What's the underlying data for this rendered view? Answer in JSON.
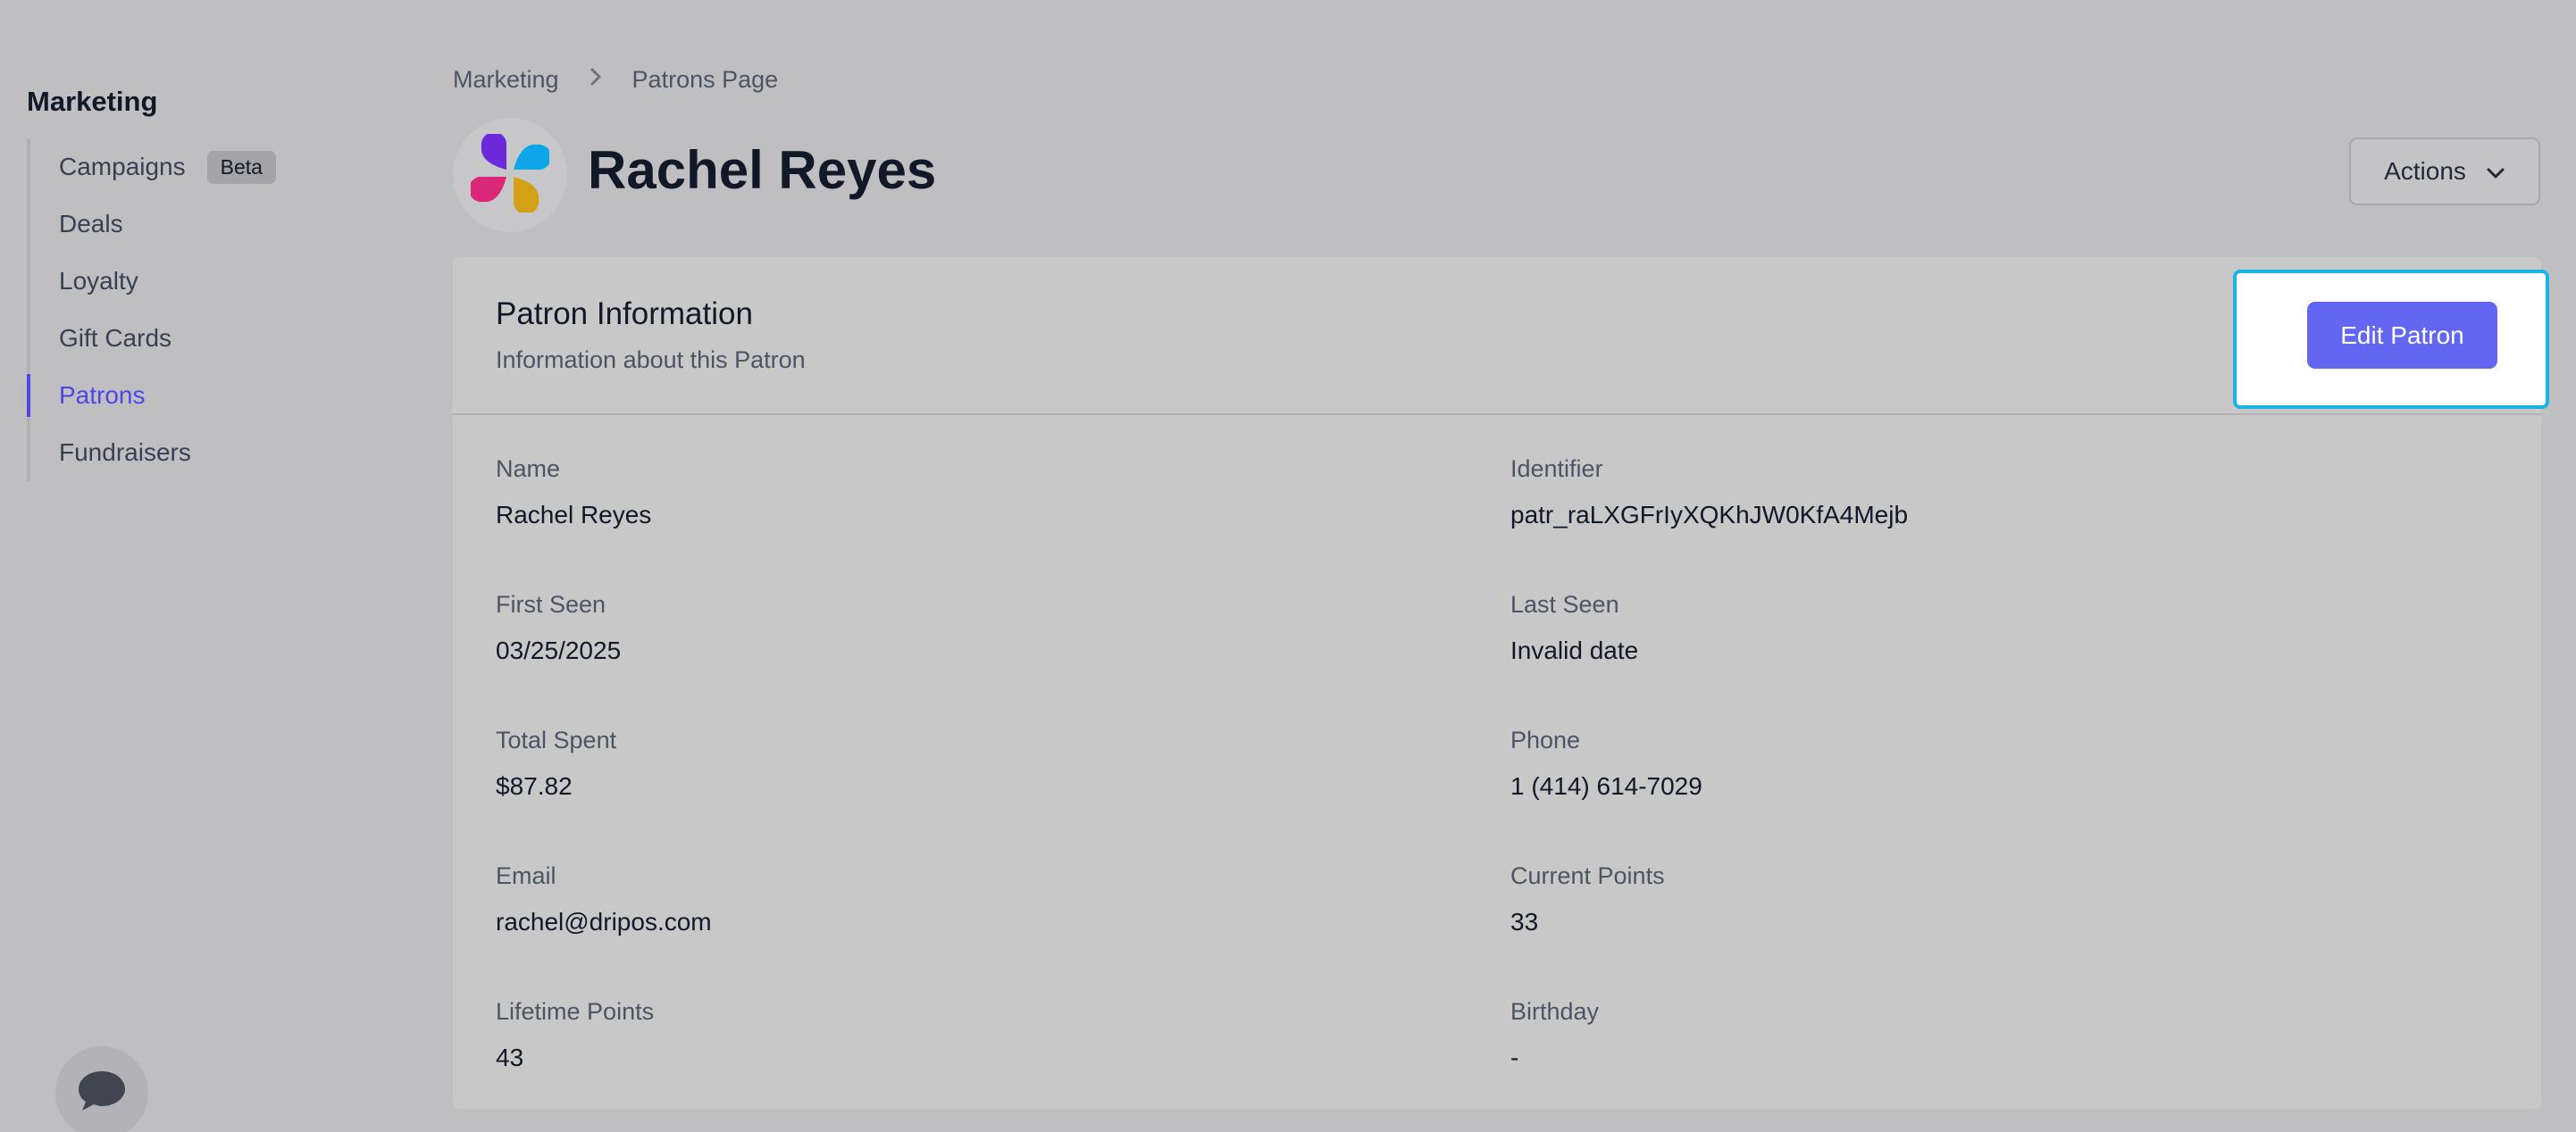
{
  "sidebar": {
    "heading": "Marketing",
    "items": [
      {
        "label": "Campaigns",
        "badge": "Beta",
        "active": false
      },
      {
        "label": "Deals",
        "active": false
      },
      {
        "label": "Loyalty",
        "active": false
      },
      {
        "label": "Gift Cards",
        "active": false
      },
      {
        "label": "Patrons",
        "active": true
      },
      {
        "label": "Fundraisers",
        "active": false
      }
    ],
    "chat_icon": "chat-bubble-icon"
  },
  "breadcrumb": {
    "items": [
      "Marketing",
      "Patrons Page"
    ],
    "separator_icon": "chevron-right-icon"
  },
  "header": {
    "avatar_icon": "pinwheel-logo-icon",
    "title": "Rachel Reyes",
    "actions_label": "Actions",
    "actions_icon": "chevron-down-icon"
  },
  "card": {
    "title": "Patron Information",
    "subtitle": "Information about this Patron",
    "edit_label": "Edit Patron",
    "fields": [
      {
        "label": "Name",
        "value": "Rachel Reyes"
      },
      {
        "label": "Identifier",
        "value": "patr_raLXGFrIyXQKhJW0KfA4Mejb"
      },
      {
        "label": "First Seen",
        "value": "03/25/2025"
      },
      {
        "label": "Last Seen",
        "value": "Invalid date"
      },
      {
        "label": "Total Spent",
        "value": "$87.82"
      },
      {
        "label": "Phone",
        "value": "1 (414) 614-7029"
      },
      {
        "label": "Email",
        "value": "rachel@dripos.com"
      },
      {
        "label": "Current Points",
        "value": "33"
      },
      {
        "label": "Lifetime Points",
        "value": "43"
      },
      {
        "label": "Birthday",
        "value": "-"
      }
    ]
  },
  "colors": {
    "accent": "#6366f1",
    "active_nav": "#4f46e5",
    "focus_ring": "#1ab3e6",
    "background": "#bfbfc2"
  }
}
